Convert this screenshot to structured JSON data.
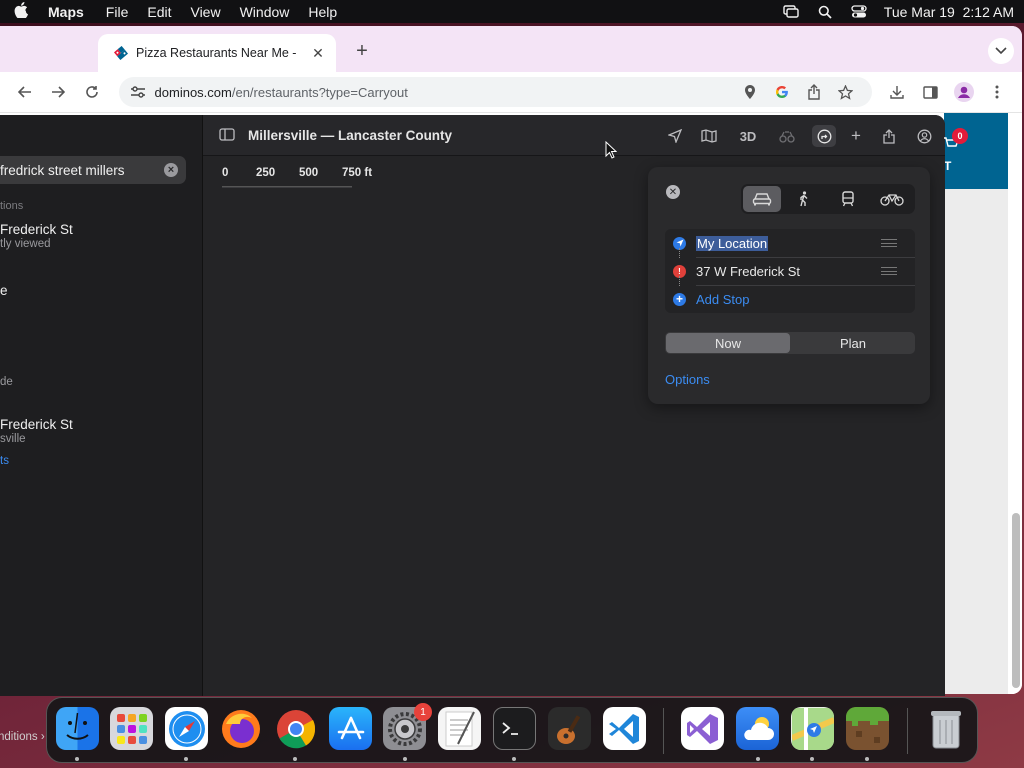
{
  "menubar": {
    "app_name": "Maps",
    "menus": [
      "File",
      "Edit",
      "View",
      "Window",
      "Help"
    ],
    "clock": "Tue Mar 19  2:12 AM"
  },
  "browser": {
    "tab_title": "Pizza Restaurants Near Me -",
    "url_host": "dominos.com",
    "url_path": "/en/restaurants?type=Carryout",
    "cart_count": "0",
    "cart_letter": "T"
  },
  "maps": {
    "search_text": "fredrick street millers",
    "sidebar": {
      "section": "tions",
      "items": [
        {
          "title": " Frederick St",
          "subtitle": "tly viewed"
        },
        {
          "title": "e",
          "subtitle": ""
        },
        {
          "title": "",
          "subtitle": "de"
        },
        {
          "title": " Frederick St",
          "subtitle": "sville"
        }
      ],
      "link": "ts"
    },
    "title": "Millersville — Lancaster County",
    "toolbar_3d": "3D",
    "scale": [
      "0",
      "250",
      "500",
      "750 ft"
    ],
    "directions": {
      "stops": [
        {
          "label": "My Location"
        },
        {
          "label": "37 W Frederick St"
        },
        {
          "label": "Add Stop"
        }
      ],
      "timing_now": "Now",
      "timing_plan": "Plan",
      "options": "Options"
    }
  },
  "dock": {
    "settings_badge": "1",
    "conditions": "nditions"
  },
  "colors": {
    "accent_blue": "#3b8cf2",
    "dominos_blue": "#006491",
    "badge_red": "#e21b3a"
  }
}
